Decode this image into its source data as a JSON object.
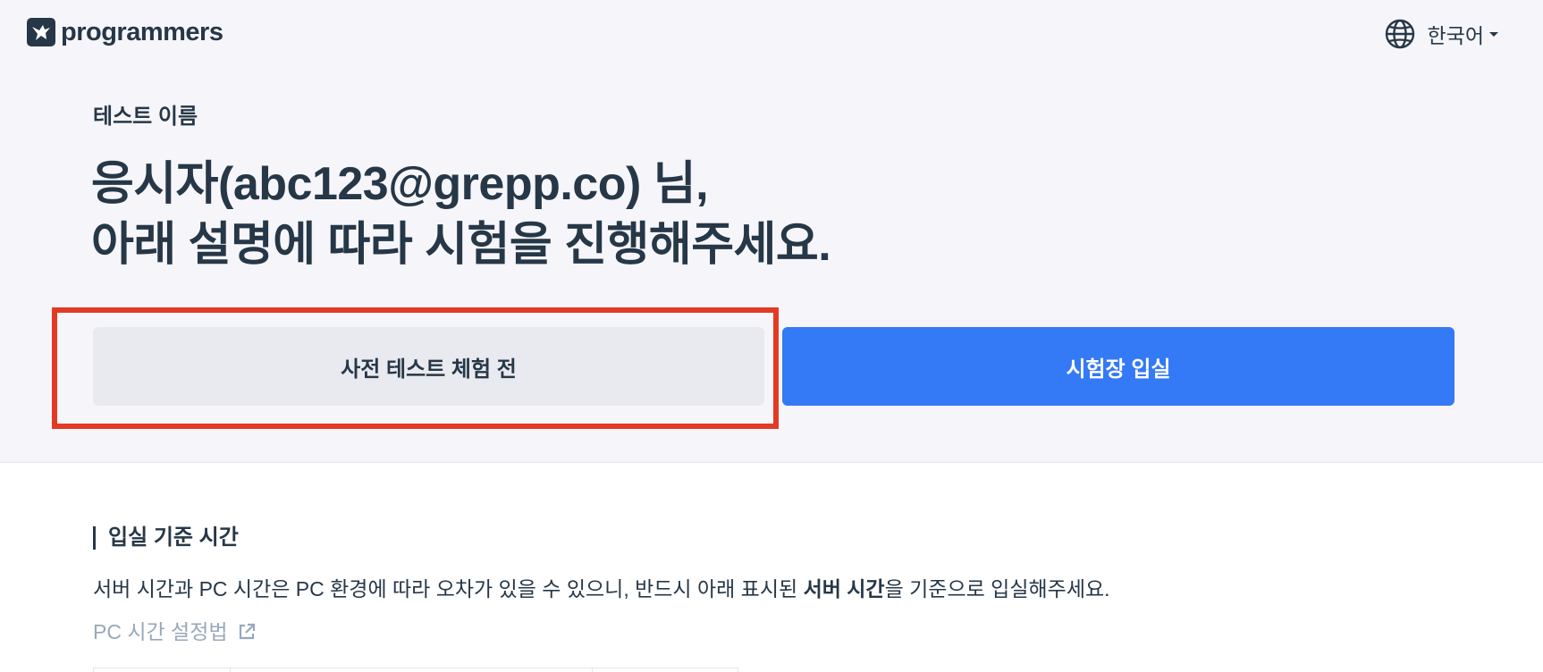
{
  "header": {
    "logo_text": "programmers",
    "language_label": "한국어"
  },
  "intro": {
    "test_name": "테스트 이름",
    "headline_line1": "응시자(abc123@grepp.co) 님,",
    "headline_line2": "아래 설명에 따라 시험을 진행해주세요."
  },
  "actions": {
    "pretest_label": "사전 테스트 체험 전",
    "enter_label": "시험장 입실"
  },
  "entry_time": {
    "title": "입실 기준 시간",
    "desc_before": "서버 시간과 PC 시간은 PC 환경에 따라 오차가 있을 수 있으니, 반드시 아래 표시된 ",
    "desc_bold": "서버 시간",
    "desc_after": "을 기준으로 입실해주세요.",
    "pc_time_link": "PC 시간 설정법"
  },
  "colors": {
    "primary": "#3479f5",
    "highlight": "#e43a25",
    "text": "#263747",
    "muted": "#98a8b9",
    "top_bg": "#f6f6fa"
  }
}
